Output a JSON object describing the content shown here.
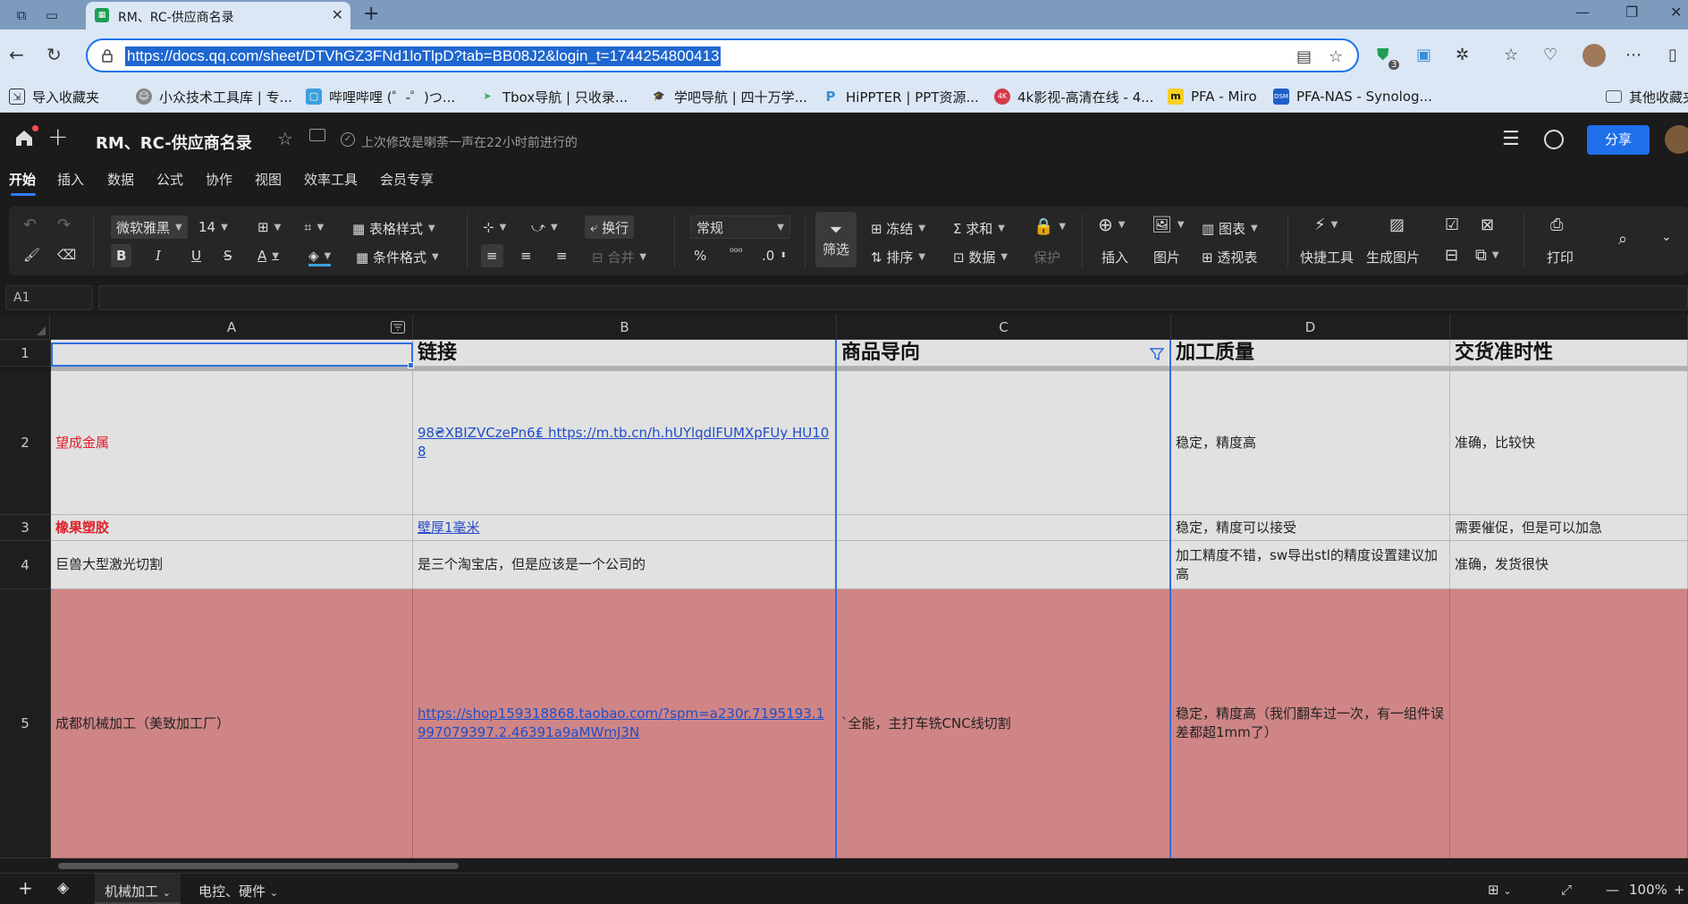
{
  "browser": {
    "tab_title": "RM、RC-供应商名录",
    "url": "https://docs.qq.com/sheet/DTVhGZ3FNd1loTlpD?tab=BB08J2&login_t=1744254800413",
    "extension_badge": "3",
    "bookmarks": [
      {
        "label": "导入收藏夹",
        "icon": "import-icon"
      },
      {
        "label": "小众技术工具库 | 专...",
        "icon": "avatar-icon"
      },
      {
        "label": "哔哩哔哩 (゜-゜)つ...",
        "icon": "bilibili-icon"
      },
      {
        "label": "Tbox导航 | 只收录...",
        "icon": "paper-plane-icon"
      },
      {
        "label": "学吧导航 | 四十万学...",
        "icon": "graduation-cap-icon"
      },
      {
        "label": "HiPPTER | PPT资源...",
        "icon": "p-logo-icon"
      },
      {
        "label": "4k影视-高清在线 - 4...",
        "icon": "4k-icon"
      },
      {
        "label": "PFA - Miro",
        "icon": "miro-icon"
      },
      {
        "label": "PFA-NAS - Synolog...",
        "icon": "dsm-icon"
      }
    ],
    "other_bookmarks": "其他收藏夹"
  },
  "doc": {
    "title": "RM、RC-供应商名录",
    "last_modified": "上次修改是喇荼一声在22小时前进行的",
    "share_label": "分享",
    "menu_tabs": [
      "开始",
      "插入",
      "数据",
      "公式",
      "协作",
      "视图",
      "效率工具",
      "会员专享"
    ]
  },
  "toolbar": {
    "font_name": "微软雅黑",
    "font_size": "14",
    "table_style": "表格样式",
    "conditional_format": "条件格式",
    "wrap": "换行",
    "merge": "合并",
    "number_format": "常规",
    "filter": "筛选",
    "freeze": "冻结",
    "sort": "排序",
    "sum": "求和",
    "data": "数据",
    "protect": "保护",
    "insert": "插入",
    "image": "图片",
    "chart": "图表",
    "pivot": "透视表",
    "quick_tools": "快捷工具",
    "gen_image": "生成图片",
    "print": "打印",
    "percent": "%",
    "thousands": "⁰⁰⁰",
    "decimal": ".0"
  },
  "formula_bar": {
    "cell_ref": "A1",
    "content": ""
  },
  "grid": {
    "columns": [
      "A",
      "B",
      "C",
      "D"
    ],
    "rows": [
      "1",
      "2",
      "3",
      "4",
      "5"
    ],
    "header_row": {
      "a": "",
      "b": "链接",
      "c": "商品导向",
      "d": "加工质量",
      "e": "交货准时性"
    },
    "r2": {
      "a": "望成金属",
      "b": "98₴XBIZVCzePn6₤ https://m.tb.cn/h.hUYlqdlFUMXpFUy HU108",
      "c": "",
      "d": "稳定，精度高",
      "e": "准确，比较快"
    },
    "r3": {
      "a": "橡果塑胶",
      "b": "壁厚1毫米",
      "c": "",
      "d": "稳定，精度可以接受",
      "e": "需要催促，但是可以加急"
    },
    "r4": {
      "a": "巨兽大型激光切割",
      "b": "是三个淘宝店，但是应该是一个公司的",
      "c": "",
      "d": "加工精度不错，sw导出stl的精度设置建议加高",
      "e": "准确，发货很快"
    },
    "r5": {
      "a": "成都机械加工（美致加工厂）",
      "b": "https://shop159318868.taobao.com/?spm=a230r.7195193.1997079397.2.46391a9aMWmJ3N",
      "c": "`全能，主打车铣CNC线切割",
      "d": "稳定，精度高（我们翻车过一次，有一组件误差都超1mm了）",
      "e": ""
    }
  },
  "sheets": [
    "机械加工",
    "电控、硬件"
  ],
  "status": {
    "zoom": "100%"
  },
  "colors": {
    "accent": "#2f6fe0",
    "row5_fill": "#cf8585",
    "share_button": "#1f6feb",
    "red_text": "#e0202a"
  }
}
